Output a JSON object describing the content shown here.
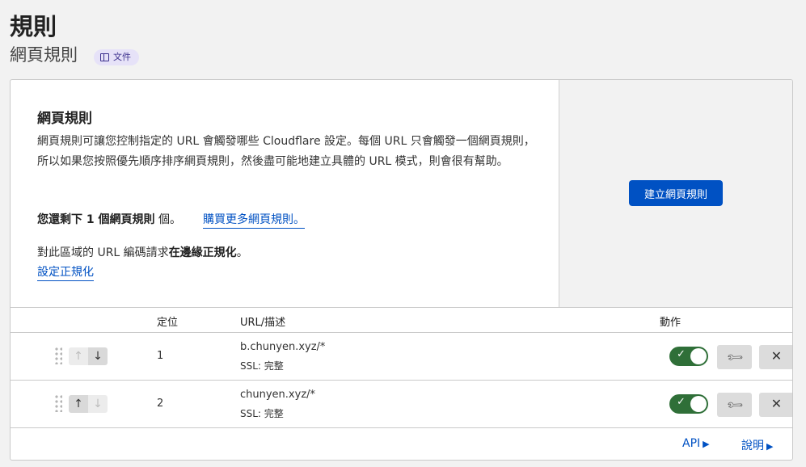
{
  "page": {
    "title": "規則",
    "subtitle": "網頁規則",
    "doc_badge": "文件"
  },
  "intro": {
    "title": "網頁規則",
    "description": "網頁規則可讓您控制指定的 URL 會觸發哪些 Cloudflare 設定。每個 URL 只會觸發一個網頁規則，所以如果您按照優先順序排序網頁規則，然後盡可能地建立具體的 URL 模式，則會很有幫助。",
    "remaining_bold": "您還剩下 1 個網頁規則",
    "remaining_suffix": " 個。",
    "buy_link": "購買更多網頁規則。",
    "normalization_prefix": "對此區域的 URL 編碼請求",
    "normalization_bold": "在邊緣正規化",
    "normalization_suffix": "。",
    "settings_link": "設定正規化"
  },
  "side": {
    "create_button": "建立網頁規則"
  },
  "table": {
    "headers": {
      "priority": "定位",
      "url": "URL/描述",
      "actions": "動作"
    },
    "rows": [
      {
        "priority": "1",
        "url": "b.chunyen.xyz/*",
        "ssl": "SSL: 完整",
        "up_enabled": false,
        "down_enabled": true,
        "enabled": true
      },
      {
        "priority": "2",
        "url": "chunyen.xyz/*",
        "ssl": "SSL: 完整",
        "up_enabled": true,
        "down_enabled": false,
        "enabled": true
      }
    ]
  },
  "footer": {
    "api_link": "API",
    "help_link": "說明"
  },
  "icons": {
    "doc": "book-icon",
    "drag": "drag-handle-icon",
    "up": "arrow-up-icon",
    "down": "arrow-down-icon",
    "edit": "wrench-icon",
    "delete": "close-icon",
    "toggle_on": "check-icon",
    "link_arrow": "triangle-right-icon"
  },
  "colors": {
    "primary": "#0051c3",
    "toggle_on": "#2f6f38",
    "badge_bg": "#e6e2f8"
  }
}
